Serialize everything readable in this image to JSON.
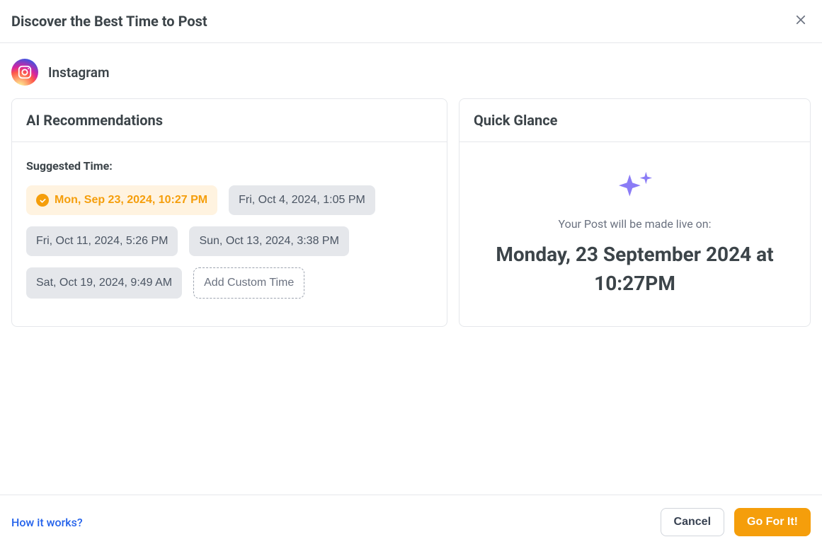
{
  "header": {
    "title": "Discover the Best Time to Post"
  },
  "platform": {
    "name": "Instagram"
  },
  "recommendations": {
    "title": "AI Recommendations",
    "suggested_label": "Suggested Time:",
    "times": [
      {
        "label": "Mon, Sep 23, 2024, 10:27 PM",
        "selected": true
      },
      {
        "label": "Fri, Oct 4, 2024, 1:05 PM",
        "selected": false
      },
      {
        "label": "Fri, Oct 11, 2024, 5:26 PM",
        "selected": false
      },
      {
        "label": "Sun, Oct 13, 2024, 3:38 PM",
        "selected": false
      },
      {
        "label": "Sat, Oct 19, 2024, 9:49 AM",
        "selected": false
      }
    ],
    "add_custom_label": "Add Custom Time"
  },
  "glance": {
    "title": "Quick Glance",
    "subtitle": "Your Post will be made live on:",
    "main": "Monday, 23 September 2024 at 10:27PM"
  },
  "footer": {
    "how_link": "How it works?",
    "cancel": "Cancel",
    "confirm": "Go For It!"
  }
}
